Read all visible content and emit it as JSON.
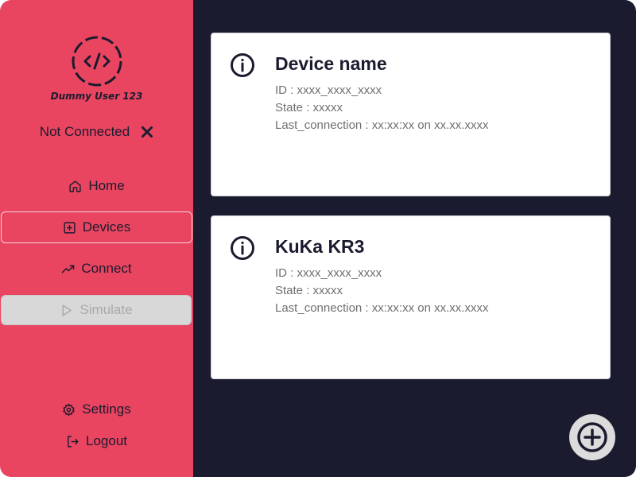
{
  "sidebar": {
    "user_name": "Dummy User 123",
    "connection_status": "Not Connected",
    "nav": {
      "home": "Home",
      "devices": "Devices",
      "connect": "Connect",
      "simulate": "Simulate"
    },
    "settings": "Settings",
    "logout": "Logout"
  },
  "devices": [
    {
      "name": "Device name",
      "id": "ID : xxxx_xxxx_xxxx",
      "state": "State : xxxxx",
      "last_connection": "Last_connection : xx:xx:xx on xx.xx.xxxx"
    },
    {
      "name": "KuKa KR3",
      "id": "ID : xxxx_xxxx_xxxx",
      "state": "State : xxxxx",
      "last_connection": "Last_connection : xx:xx:xx on xx.xx.xxxx"
    }
  ],
  "colors": {
    "sidebar_bg": "#e94560",
    "main_bg": "#1b1b2f",
    "card_bg": "#ffffff",
    "text_dark": "#1b1b2f",
    "text_muted": "#6f6f6f"
  },
  "icons": {
    "logo": "code-icon",
    "status": "close-icon",
    "home": "home-icon",
    "devices": "plus-square-icon",
    "connect": "trending-up-icon",
    "simulate": "play-icon",
    "settings": "gear-icon",
    "logout": "logout-icon",
    "device_info": "info-icon",
    "add": "plus-circle-icon"
  }
}
